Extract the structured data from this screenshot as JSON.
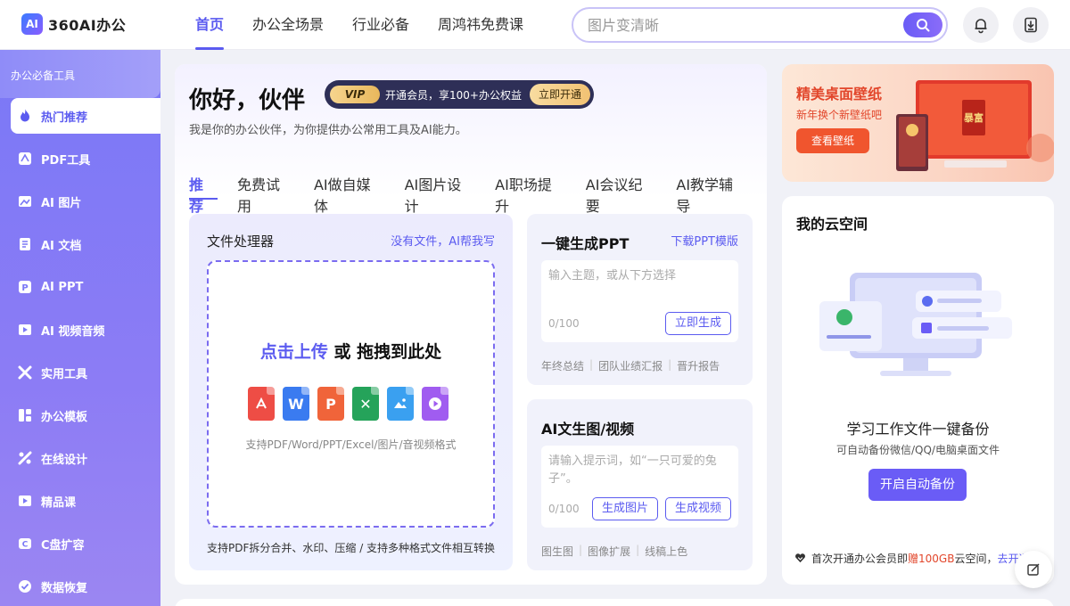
{
  "app": {
    "logo_mark": "AI",
    "logo_text": "360AI办公"
  },
  "nav": {
    "items": [
      "首页",
      "办公全场景",
      "行业必备",
      "周鸿祎免费课"
    ],
    "active": 0
  },
  "search": {
    "placeholder": "图片变清晰"
  },
  "sidebar": {
    "title": "办公必备工具",
    "items": [
      {
        "label": "热门推荐",
        "icon": "flame-icon"
      },
      {
        "label": "PDF工具",
        "icon": "pdf-icon"
      },
      {
        "label": "AI 图片",
        "icon": "image-icon"
      },
      {
        "label": "AI 文档",
        "icon": "document-icon"
      },
      {
        "label": "AI PPT",
        "icon": "ppt-icon"
      },
      {
        "label": "AI 视频音频",
        "icon": "video-icon"
      },
      {
        "label": "实用工具",
        "icon": "tools-icon"
      },
      {
        "label": "办公模板",
        "icon": "template-icon"
      },
      {
        "label": "在线设计",
        "icon": "design-icon"
      },
      {
        "label": "精品课",
        "icon": "course-icon"
      },
      {
        "label": "C盘扩容",
        "icon": "disk-icon"
      },
      {
        "label": "数据恢复",
        "icon": "recover-icon"
      }
    ]
  },
  "main": {
    "greeting": "你好，伙伴",
    "vip": {
      "badge": "VIP",
      "text": "开通会员，享100+办公权益",
      "button": "立即开通"
    },
    "subtitle": "我是你的办公伙伴，为你提供办公常用工具及AI能力。",
    "tabs": [
      "推荐",
      "免费试用",
      "AI做自媒体",
      "AI图片设计",
      "AI职场提升",
      "AI会议纪要",
      "AI教学辅导"
    ],
    "file_processor": {
      "title": "文件处理器",
      "link": "没有文件，AI帮我写",
      "drop_highlight": "点击上传",
      "drop_rest": " 或 拖拽到此处",
      "file_types": [
        {
          "label": "PDF",
          "color": "#ee4d45",
          "glyph": "⅄"
        },
        {
          "label": "Word",
          "color": "#3a7bf0",
          "glyph": "W"
        },
        {
          "label": "PPT",
          "color": "#f0643a",
          "glyph": "P"
        },
        {
          "label": "Excel",
          "color": "#25a35a",
          "glyph": "✕"
        },
        {
          "label": "图片",
          "color": "#3aa0f0",
          "glyph": "⛰"
        },
        {
          "label": "音视频",
          "color": "#a05cf0",
          "glyph": "▶"
        }
      ],
      "hint": "支持PDF/Word/PPT/Excel/图片/音视频格式",
      "footer": "支持PDF拆分合并、水印、压缩 / 支持多种格式文件相互转换"
    },
    "ppt": {
      "title": "一键生成PPT",
      "link": "下载PPT模版",
      "placeholder": "输入主题，或从下方选择",
      "count": "0/100",
      "button": "立即生成",
      "tags": [
        "年终总结",
        "团队业绩汇报",
        "晋升报告"
      ]
    },
    "ai_gen": {
      "title": "AI文生图/视频",
      "placeholder": "请输入提示词，如“一只可爱的兔子”。",
      "count": "0/100",
      "button_image": "生成图片",
      "button_video": "生成视频",
      "tags": [
        "图生图",
        "图像扩展",
        "线稿上色"
      ]
    }
  },
  "banner": {
    "title": "精美桌面壁纸",
    "subtitle": "新年换个新壁纸吧",
    "button": "查看壁纸",
    "art_text": "暴富"
  },
  "cloud": {
    "title": "我的云空间",
    "headline": "学习工作文件一键备份",
    "desc": "可自动备份微信/QQ/电脑桌面文件",
    "button": "开启自动备份",
    "footer_pre": "首次开通办公会员即",
    "footer_red": "赠100GB",
    "footer_post": "云空间，",
    "footer_link": "去开通"
  },
  "colors": {
    "accent": "#5b5bf0",
    "sidebar": "#7a78f6",
    "banner_red": "#e2462b"
  }
}
